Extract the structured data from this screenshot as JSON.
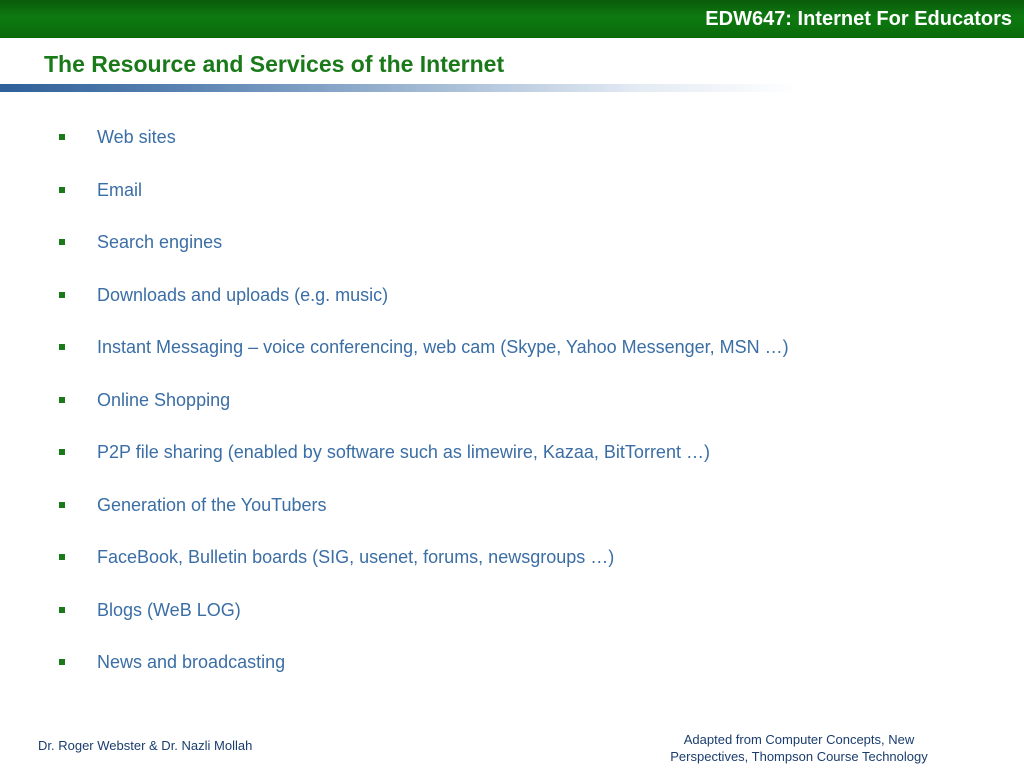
{
  "header": {
    "course_title": "EDW647:  Internet For Educators"
  },
  "slide": {
    "title": "The Resource and Services of the Internet",
    "bullets": [
      "Web sites",
      "Email",
      "Search engines",
      "Downloads and uploads (e.g. music)",
      "Instant Messaging – voice conferencing, web cam (Skype, Yahoo Messenger, MSN …)",
      "Online Shopping",
      "P2P file sharing (enabled by software such as limewire, Kazaa, BitTorrent …)",
      "Generation of the YouTubers",
      "FaceBook, Bulletin boards (SIG, usenet, forums, newsgroups …)",
      "Blogs (WeB LOG)",
      "News and broadcasting"
    ]
  },
  "footer": {
    "authors": "Dr. Roger Webster & Dr. Nazli Mollah",
    "source_line1": "Adapted from Computer Concepts, New",
    "source_line2": "Perspectives, Thompson Course Technology"
  },
  "colors": {
    "header_band": "#0d7a10",
    "title": "#1a7a1a",
    "bullet_text": "#3a6ea5",
    "bullet_marker": "#1a7a1a",
    "footer_text": "#1a3d6e"
  }
}
